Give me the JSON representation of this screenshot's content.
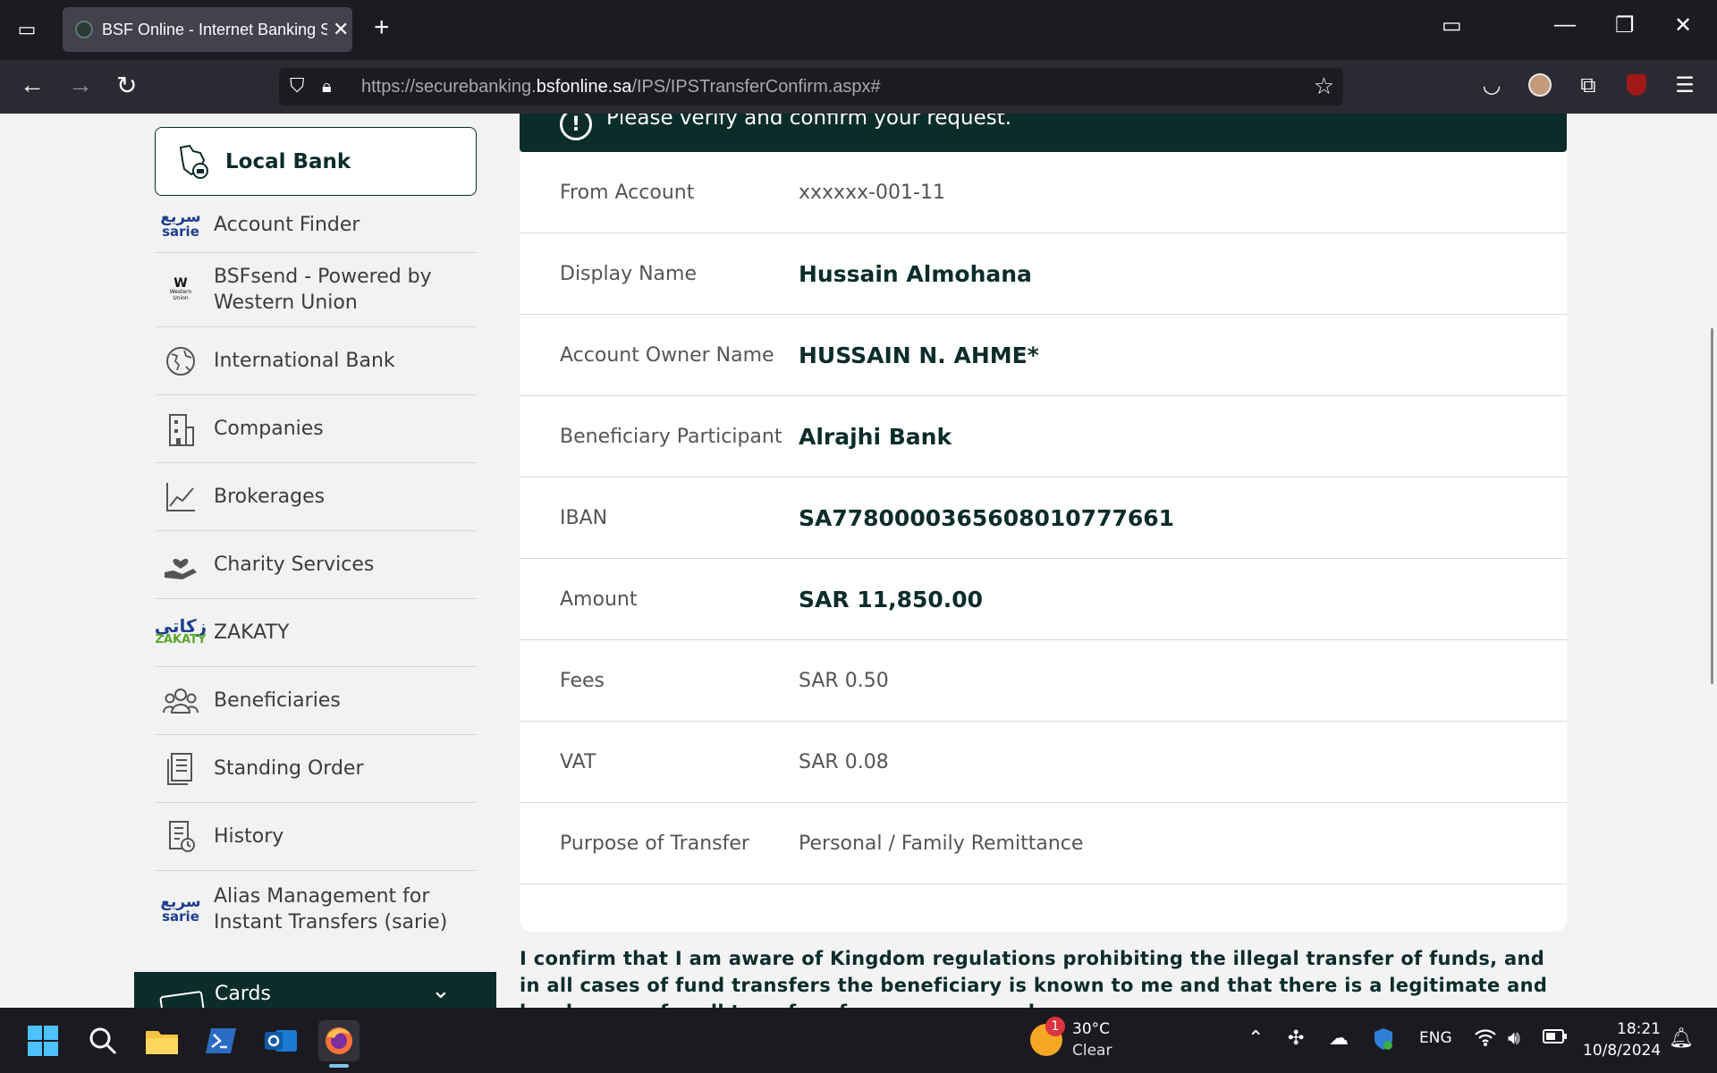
{
  "browser": {
    "tab_title": "BSF Online - Internet Banking S",
    "url_prefix": "https://securebanking.",
    "url_domain": "bsfonline.sa",
    "url_path": "/IPS/IPSTransferConfirm.aspx#"
  },
  "sidebar": {
    "active_item": "Local Bank",
    "items": [
      {
        "label": "Account Finder",
        "icon": "sarie-logo"
      },
      {
        "label": "BSFsend - Powered by Western Union",
        "icon": "western-union-logo"
      },
      {
        "label": "International Bank",
        "icon": "globe-icon"
      },
      {
        "label": "Companies",
        "icon": "building-icon"
      },
      {
        "label": "Brokerages",
        "icon": "chart-icon"
      },
      {
        "label": "Charity Services",
        "icon": "charity-hand-icon"
      },
      {
        "label": "ZAKATY",
        "icon": "zakaty-logo"
      },
      {
        "label": "Beneficiaries",
        "icon": "people-icon"
      },
      {
        "label": "Standing Order",
        "icon": "document-icon"
      },
      {
        "label": "History",
        "icon": "history-icon"
      },
      {
        "label": "Alias Management for Instant Transfers (sarie)",
        "icon": "sarie-logo"
      }
    ],
    "cards_label": "Cards",
    "sarie_logo_ar": "سريع",
    "sarie_logo_en": "sarie",
    "zakaty_logo_ar": "زكاتي",
    "zakaty_logo_en": "ZAKATY",
    "wu_logo_w": "W",
    "wu_logo_text": "Western Union"
  },
  "main": {
    "banner_text": "Please verify and confirm your request.",
    "rows": [
      {
        "label": "From Account",
        "value": "xxxxxx-001-11",
        "bold": false
      },
      {
        "label": "Display Name",
        "value": "Hussain Almohana",
        "bold": true
      },
      {
        "label": "Account Owner Name",
        "value": "HUSSAIN N. AHME*",
        "bold": true
      },
      {
        "label": "Beneficiary Participant",
        "value": "Alrajhi Bank",
        "bold": true
      },
      {
        "label": "IBAN",
        "value": "SA7780000365608010777661",
        "bold": true
      },
      {
        "label": "Amount",
        "value": "SAR 11,850.00",
        "bold": true
      },
      {
        "label": "Fees",
        "value": "SAR 0.50",
        "bold": false
      },
      {
        "label": "VAT",
        "value": "SAR 0.08",
        "bold": false
      },
      {
        "label": "Purpose of Transfer",
        "value": "Personal / Family Remittance",
        "bold": false
      }
    ],
    "confirm_text": "I confirm that I am aware of Kingdom regulations prohibiting the illegal transfer of funds, and in all cases of fund transfers the beneficiary is known to me and that there is a legitimate and legal reason for all transfer of money or regard"
  },
  "taskbar": {
    "weather_temp": "30°C",
    "weather_cond": "Clear",
    "weather_badge": "1",
    "lang": "ENG",
    "time": "18:21",
    "date": "10/8/2024"
  },
  "colors": {
    "brand_dark": "#0b2d2a",
    "sarie_blue": "#1f3f8f",
    "sarie_teal": "#3aa0c8",
    "zakaty_green": "#5aa829"
  }
}
